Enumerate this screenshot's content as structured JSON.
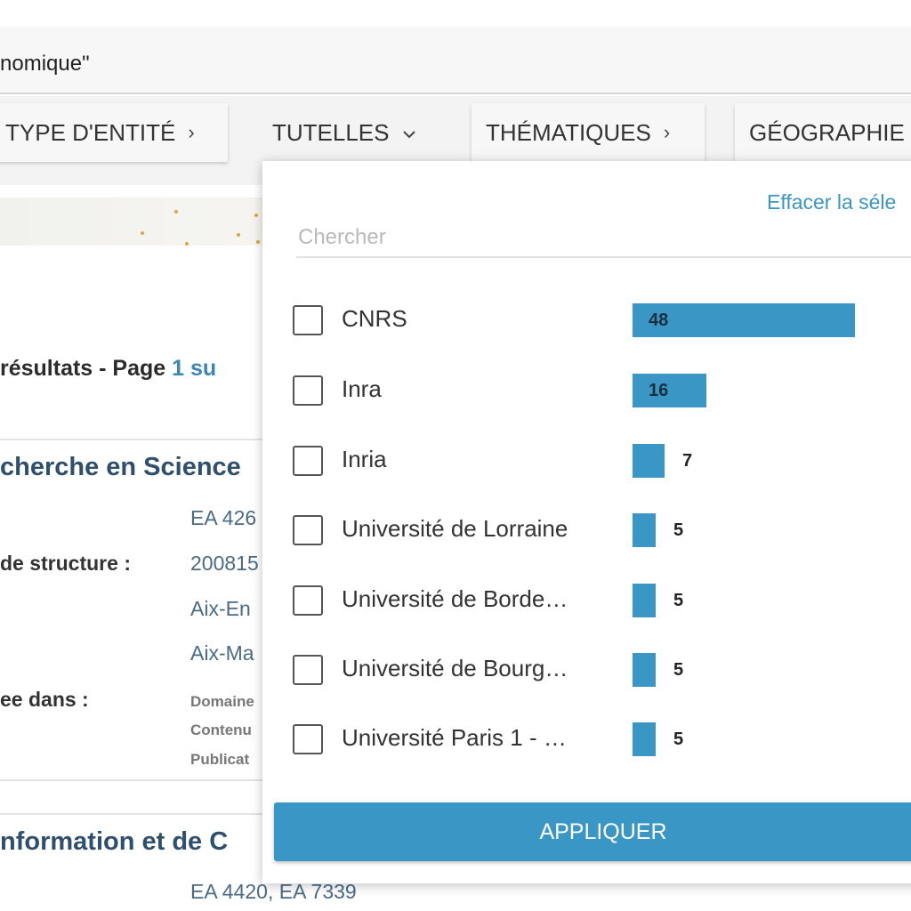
{
  "search": {
    "query_text": "nomique\""
  },
  "filters": {
    "type_entite": "TYPE D'ENTITÉ",
    "tutelles": "TUTELLES",
    "thematiques": "THÉMATIQUES",
    "geographie": "GÉOGRAPHIE",
    "chevron_right": "›",
    "chevron_down": "⌄"
  },
  "results": {
    "summary_prefix": "résultats  - Page ",
    "page_current": "1",
    "summary_suffix": " su",
    "item1": {
      "title": "cherche en Science",
      "id_value": "EA 426",
      "struct_label": "de structure :",
      "struct_value": "200815",
      "city": "Aix-En",
      "univ": "Aix-Ma",
      "listed_label": "ee dans :",
      "tag1": "Domaine",
      "tag2": "Contenu",
      "tag3": "Publicat"
    },
    "item2": {
      "title": "nformation et de C",
      "id_value": "EA 4420, EA 7339"
    }
  },
  "dropdown": {
    "clear_label": "Effacer la séle",
    "search_placeholder": "Chercher",
    "apply_label": "APPLIQUER",
    "max_count": 48,
    "items": [
      {
        "label": "CNRS",
        "count": "48",
        "value": 48
      },
      {
        "label": "Inra",
        "count": "16",
        "value": 16
      },
      {
        "label": "Inria",
        "count": "7",
        "value": 7
      },
      {
        "label": "Université de Lorraine",
        "count": "5",
        "value": 5
      },
      {
        "label": "Université de Borde…",
        "count": "5",
        "value": 5
      },
      {
        "label": "Université de Bourg…",
        "count": "5",
        "value": 5
      },
      {
        "label": "Université Paris 1 - …",
        "count": "5",
        "value": 5
      }
    ]
  },
  "colors": {
    "accent": "#3a96c4",
    "title": "#2f4f6f"
  }
}
